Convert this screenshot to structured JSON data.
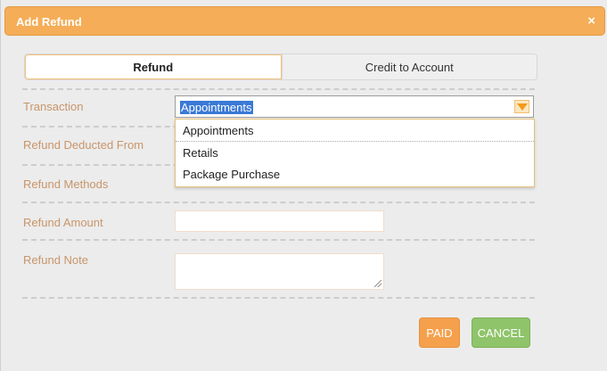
{
  "dialog": {
    "title": "Add Refund",
    "close_glyph": "×"
  },
  "tabs": [
    {
      "label": "Refund",
      "active": true
    },
    {
      "label": "Credit to Account",
      "active": false
    }
  ],
  "form": {
    "transaction_label": "Transaction",
    "transaction_value": "Appointments",
    "deducted_from_label": "Refund Deducted From",
    "methods_label": "Refund Methods",
    "amount_label": "Refund Amount",
    "amount_value": "",
    "note_label": "Refund Note",
    "note_value": ""
  },
  "dropdown": {
    "options": [
      "Appointments",
      "Retails",
      "Package Purchase"
    ]
  },
  "buttons": {
    "paid": "PAID",
    "cancel": "CANCEL"
  },
  "colors": {
    "title_bar": "#f5ad57",
    "label": "#c8956a",
    "paid": "#f5a04c",
    "cancel": "#8fc46a",
    "selection": "#3a79d6"
  }
}
